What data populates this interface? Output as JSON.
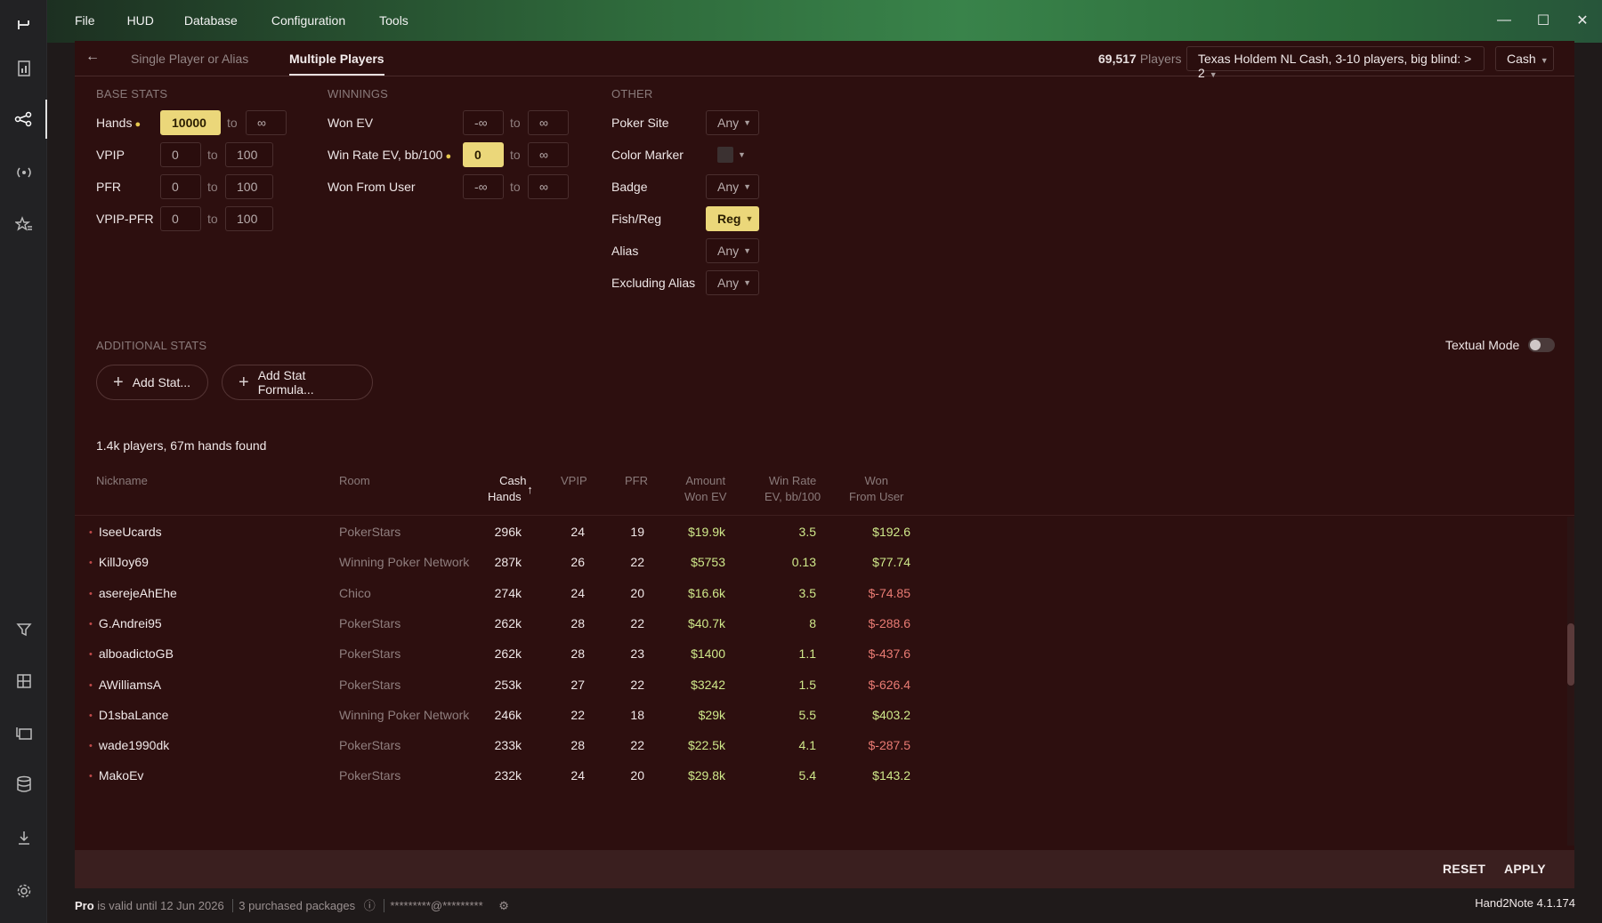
{
  "menu": [
    "File",
    "HUD",
    "Database",
    "Configuration",
    "Tools"
  ],
  "window_controls": {
    "minimize": "—",
    "maximize": "☐",
    "close": "✕"
  },
  "sidebar_icons": [
    "logo-icon",
    "reports-icon",
    "players-icon",
    "hud-live-icon",
    "favorites-icon",
    "filter-icon",
    "layout-icon",
    "replayer-icon",
    "database-icon",
    "download-icon",
    "settings-icon"
  ],
  "tabs": {
    "single": "Single Player or Alias",
    "multiple": "Multiple Players"
  },
  "player_count": {
    "value": "69,517",
    "label": "Players"
  },
  "game_filter": "Texas Holdem NL Cash, 3-10 players, big blind: > 2",
  "game_type": "Cash",
  "base_stats": {
    "title": "BASE STATS",
    "rows": [
      {
        "label": "Hands",
        "from": "10000",
        "to": "∞",
        "marked": true
      },
      {
        "label": "VPIP",
        "from": "0",
        "to": "100",
        "marked": false
      },
      {
        "label": "PFR",
        "from": "0",
        "to": "100",
        "marked": false
      },
      {
        "label": "VPIP-PFR",
        "from": "0",
        "to": "100",
        "marked": false
      }
    ],
    "to_label": "to"
  },
  "winnings": {
    "title": "WINNINGS",
    "rows": [
      {
        "label": "Won EV",
        "from": "-∞",
        "to": "∞",
        "marked": false
      },
      {
        "label": "Win Rate EV, bb/100",
        "from": "0",
        "to": "∞",
        "marked": true
      },
      {
        "label": "Won From User",
        "from": "-∞",
        "to": "∞",
        "marked": false
      }
    ]
  },
  "other": {
    "title": "OTHER",
    "rows": [
      {
        "label": "Poker Site",
        "value": "Any"
      },
      {
        "label": "Color Marker",
        "value": ""
      },
      {
        "label": "Badge",
        "value": "Any"
      },
      {
        "label": "Fish/Reg",
        "value": "Reg"
      },
      {
        "label": "Alias",
        "value": "Any"
      },
      {
        "label": "Excluding Alias",
        "value": "Any"
      }
    ]
  },
  "additional": {
    "title": "ADDITIONAL STATS",
    "add_stat": "Add Stat...",
    "add_formula": "Add Stat Formula...",
    "textual_mode": "Textual Mode",
    "textual_mode_on": false
  },
  "results_summary": "1.4k players, 67m hands found",
  "table": {
    "headers": {
      "nickname": "Nickname",
      "room": "Room",
      "cash_hands_1": "Cash",
      "cash_hands_2": "Hands",
      "sort_arrow": "↑",
      "vpip": "VPIP",
      "pfr": "PFR",
      "amount_1": "Amount",
      "amount_2": "Won EV",
      "winrate_1": "Win Rate",
      "winrate_2": "EV, bb/100",
      "wonfrom_1": "Won",
      "wonfrom_2": "From User"
    },
    "rows": [
      {
        "nick": "IseeUcards",
        "room": "PokerStars",
        "hands": "296k",
        "vpip": "24",
        "pfr": "19",
        "won": "$19.9k",
        "wr": "3.5",
        "user": "$192.6",
        "user_neg": false
      },
      {
        "nick": "KillJoy69",
        "room": "Winning Poker Network",
        "hands": "287k",
        "vpip": "26",
        "pfr": "22",
        "won": "$5753",
        "wr": "0.13",
        "user": "$77.74",
        "user_neg": false
      },
      {
        "nick": "aserejeAhEhe",
        "room": "Chico",
        "hands": "274k",
        "vpip": "24",
        "pfr": "20",
        "won": "$16.6k",
        "wr": "3.5",
        "user": "$-74.85",
        "user_neg": true
      },
      {
        "nick": "G.Andrei95",
        "room": "PokerStars",
        "hands": "262k",
        "vpip": "28",
        "pfr": "22",
        "won": "$40.7k",
        "wr": "8",
        "user": "$-288.6",
        "user_neg": true
      },
      {
        "nick": "alboadictoGB",
        "room": "PokerStars",
        "hands": "262k",
        "vpip": "28",
        "pfr": "23",
        "won": "$1400",
        "wr": "1.1",
        "user": "$-437.6",
        "user_neg": true
      },
      {
        "nick": "AWilliamsA",
        "room": "PokerStars",
        "hands": "253k",
        "vpip": "27",
        "pfr": "22",
        "won": "$3242",
        "wr": "1.5",
        "user": "$-626.4",
        "user_neg": true
      },
      {
        "nick": "D1sbaLance",
        "room": "Winning Poker Network",
        "hands": "246k",
        "vpip": "22",
        "pfr": "18",
        "won": "$29k",
        "wr": "5.5",
        "user": "$403.2",
        "user_neg": false
      },
      {
        "nick": "wade1990dk",
        "room": "PokerStars",
        "hands": "233k",
        "vpip": "28",
        "pfr": "22",
        "won": "$22.5k",
        "wr": "4.1",
        "user": "$-287.5",
        "user_neg": true
      },
      {
        "nick": "MakoEv",
        "room": "PokerStars",
        "hands": "232k",
        "vpip": "24",
        "pfr": "20",
        "won": "$29.8k",
        "wr": "5.4",
        "user": "$143.2",
        "user_neg": false
      }
    ]
  },
  "footer": {
    "reset": "RESET",
    "apply": "APPLY"
  },
  "status": {
    "pro": "Pro",
    "valid": "is valid until 12 Jun 2026",
    "packages": "3 purchased packages",
    "account": "*********@*********",
    "version": "Hand2Note 4.1.174"
  }
}
